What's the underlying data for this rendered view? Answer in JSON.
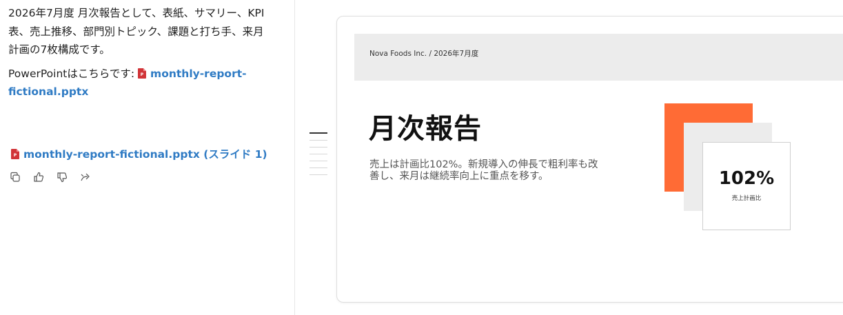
{
  "chat": {
    "message_text": "2026年7月度 月次報告として、表紙、サマリー、KPI表、売上推移、部門別トピック、課題と打ち手、来月計画の7枚構成です。",
    "link_prefix": "PowerPointはこちらです: ",
    "link_filename": "monthly-report-fictional.pptx",
    "attachment_label": "monthly-report-fictional.pptx (スライド 1)",
    "actions": [
      "copy-icon",
      "thumbs-up-icon",
      "thumbs-down-icon",
      "share-icon"
    ],
    "file_icon_color": "#d13438",
    "link_color": "#2f7bc4"
  },
  "slide_nav": {
    "count": 7,
    "active_index": 0
  },
  "slide": {
    "header": "Nova Foods Inc. / 2026年7月度",
    "title": "月次報告",
    "body": "売上は計画比102%。新規導入の伸長で粗利率も改善し、来月は継続率向上に重点を移す。",
    "kpi_value": "102%",
    "kpi_label": "売上計画比",
    "accent_color": "#ff6b35"
  }
}
